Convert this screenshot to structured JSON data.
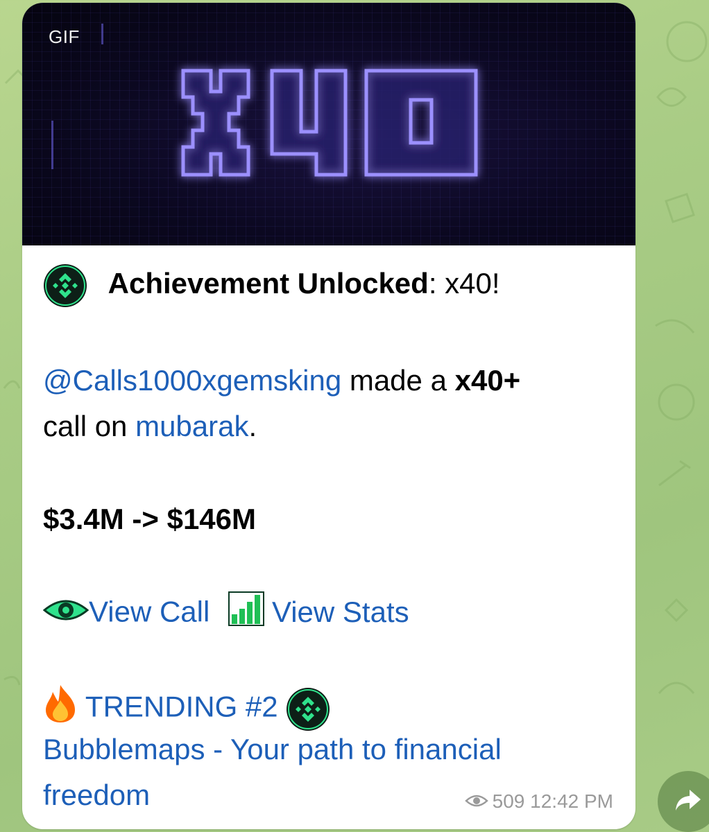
{
  "media": {
    "badge": "GIF",
    "image_text": "x40"
  },
  "message": {
    "title_bold": "Achievement Unlocked",
    "title_rest": ": x40!",
    "mention": "@Calls1000xgemsking",
    "made_a": " made a ",
    "multiplier": "x40+",
    "call_on": "call on ",
    "token": "mubarak",
    "period": ".",
    "price_change": "$3.4M -> $146M",
    "view_call": "View Call",
    "view_stats": "View Stats",
    "trending": " TRENDING #2",
    "promo_line1": "Bubblemaps - Your path to financial",
    "promo_line2": "freedom"
  },
  "meta": {
    "views": "509",
    "time": "12:42 PM"
  },
  "icons": {
    "coin": "binance-coin-icon",
    "eye": "eye-icon",
    "chart": "bar-chart-icon",
    "fire": "fire-icon",
    "views": "views-eye-icon",
    "share": "share-icon"
  },
  "colors": {
    "link": "#1d5fb8",
    "neon": "#8a7dff",
    "coin_green": "#2fe28c",
    "wallpaper": "#a9cc85"
  }
}
